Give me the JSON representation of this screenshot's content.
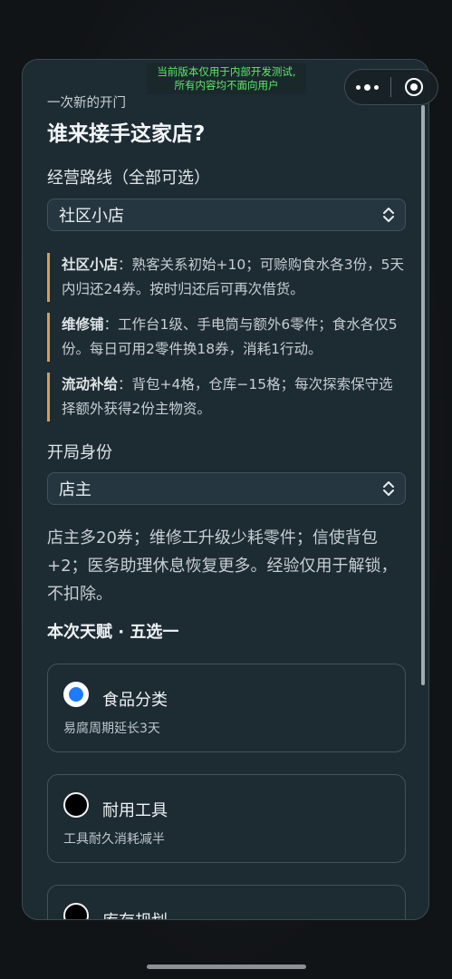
{
  "dev_banner": {
    "line1": "当前版本仅用于内部开发测试,",
    "line2": "所有内容均不面向用户"
  },
  "header": {
    "subtitle": "一次新的开门",
    "title": "谁来接手这家店?"
  },
  "route": {
    "label": "经营路线（全部可选）",
    "selected": "社区小店",
    "notes": [
      {
        "name": "社区小店",
        "text": "：熟客关系初始+10；可赊购食水各3份，5天内归还24券。按时归还后可再次借货。"
      },
      {
        "name": "维修铺",
        "text": "：工作台1级、手电筒与额外6零件；食水各仅5份。每日可用2零件换18券，消耗1行动。"
      },
      {
        "name": "流动补给",
        "text": "：背包+4格，仓库−15格；每次探索保守选择额外获得2份主物资。"
      }
    ]
  },
  "identity": {
    "label": "开局身份",
    "selected": "店主",
    "description": "店主多20券；维修工升级少耗零件；信使背包+2；医务助理休息恢复更多。经验仅用于解锁，不扣除。"
  },
  "talents": {
    "title": "本次天赋 · 五选一",
    "options": [
      {
        "name": "食品分类",
        "effect": "易腐周期延长3天",
        "checked": true
      },
      {
        "name": "耐用工具",
        "effect": "工具耐久消耗减半",
        "checked": false
      },
      {
        "name": "库存规划",
        "effect": "",
        "checked": false
      }
    ]
  },
  "colors": {
    "accent_radio": "#1e7bff",
    "note_border": "#d59e59",
    "dev_text": "#5ee86a"
  },
  "icons": [
    "more-dots-icon",
    "close-circle-icon",
    "chevron-updown-icon"
  ]
}
